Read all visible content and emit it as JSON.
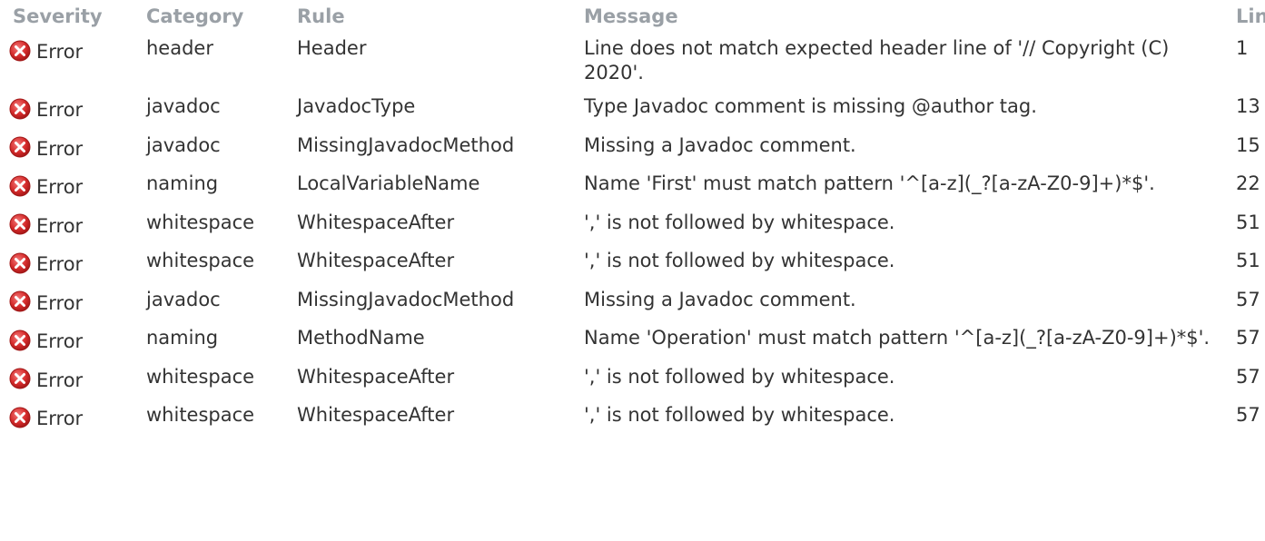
{
  "headers": {
    "severity": "Severity",
    "category": "Category",
    "rule": "Rule",
    "message": "Message",
    "line": "Line"
  },
  "icons": {
    "error": "error-icon",
    "error_color": "#cc2222"
  },
  "rows": [
    {
      "severity": "Error",
      "category": "header",
      "rule": "Header",
      "message": "Line does not match expected header line of '// Copyright (C) 2020'.",
      "line": "1"
    },
    {
      "severity": "Error",
      "category": "javadoc",
      "rule": "JavadocType",
      "message": "Type Javadoc comment is missing @author tag.",
      "line": "13"
    },
    {
      "severity": "Error",
      "category": "javadoc",
      "rule": "MissingJavadocMethod",
      "message": "Missing a Javadoc comment.",
      "line": "15"
    },
    {
      "severity": "Error",
      "category": "naming",
      "rule": "LocalVariableName",
      "message": "Name 'First' must match pattern '^[a-z](_?[a-zA-Z0-9]+)*$'.",
      "line": "22"
    },
    {
      "severity": "Error",
      "category": "whitespace",
      "rule": "WhitespaceAfter",
      "message": "',' is not followed by whitespace.",
      "line": "51"
    },
    {
      "severity": "Error",
      "category": "whitespace",
      "rule": "WhitespaceAfter",
      "message": "',' is not followed by whitespace.",
      "line": "51"
    },
    {
      "severity": "Error",
      "category": "javadoc",
      "rule": "MissingJavadocMethod",
      "message": "Missing a Javadoc comment.",
      "line": "57"
    },
    {
      "severity": "Error",
      "category": "naming",
      "rule": "MethodName",
      "message": "Name 'Operation' must match pattern '^[a-z](_?[a-zA-Z0-9]+)*$'.",
      "line": "57"
    },
    {
      "severity": "Error",
      "category": "whitespace",
      "rule": "WhitespaceAfter",
      "message": "',' is not followed by whitespace.",
      "line": "57"
    },
    {
      "severity": "Error",
      "category": "whitespace",
      "rule": "WhitespaceAfter",
      "message": "',' is not followed by whitespace.",
      "line": "57"
    }
  ]
}
